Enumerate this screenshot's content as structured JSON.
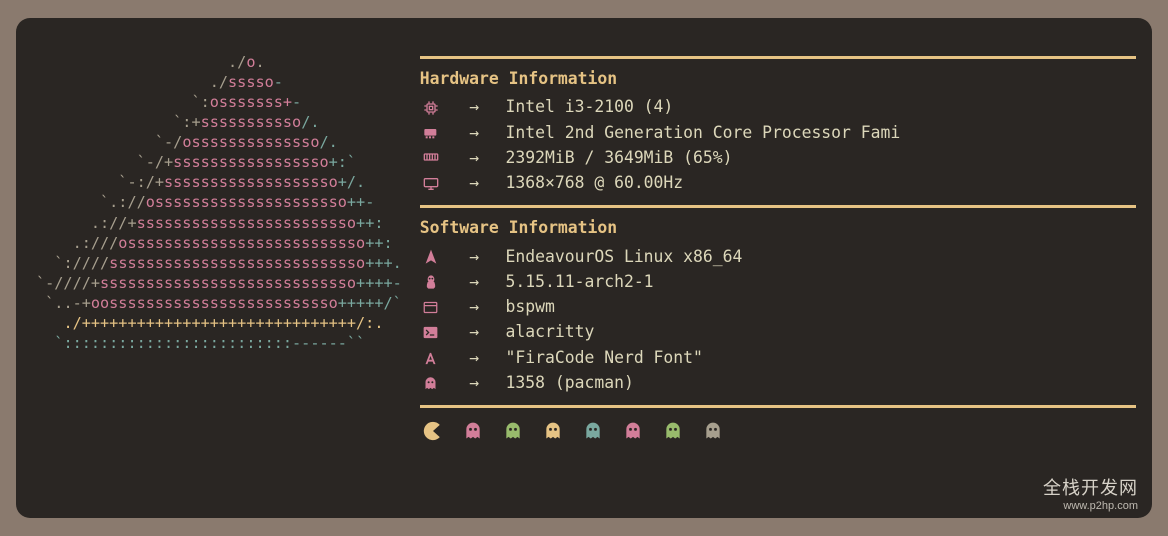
{
  "hardware": {
    "title": "Hardware Information",
    "items": [
      {
        "icon": "cpu-icon",
        "value": "Intel i3-2100 (4)"
      },
      {
        "icon": "gpu-icon",
        "value": "Intel 2nd Generation Core Processor Fami"
      },
      {
        "icon": "memory-icon",
        "value": "2392MiB / 3649MiB (65%)"
      },
      {
        "icon": "display-icon",
        "value": "1368×768 @ 60.00Hz"
      }
    ]
  },
  "software": {
    "title": "Software Information",
    "items": [
      {
        "icon": "distro-icon",
        "value": "EndeavourOS Linux x86_64"
      },
      {
        "icon": "kernel-icon",
        "value": "5.15.11-arch2-1"
      },
      {
        "icon": "wm-icon",
        "value": "bspwm"
      },
      {
        "icon": "terminal-icon",
        "value": "alacritty"
      },
      {
        "icon": "font-icon",
        "value": "\"FiraCode Nerd Font\""
      },
      {
        "icon": "packages-icon",
        "value": "1358 (pacman)"
      }
    ]
  },
  "arrow": "→",
  "colors": {
    "pacman": "#e6c384",
    "ghosts": [
      "#d27e99",
      "#98bb6c",
      "#e6c384",
      "#7aa89f",
      "#d27e99",
      "#98bb6c",
      "#a79f8e"
    ]
  },
  "watermark": {
    "big": "全栈开发网",
    "small": "www.p2hp.com"
  }
}
